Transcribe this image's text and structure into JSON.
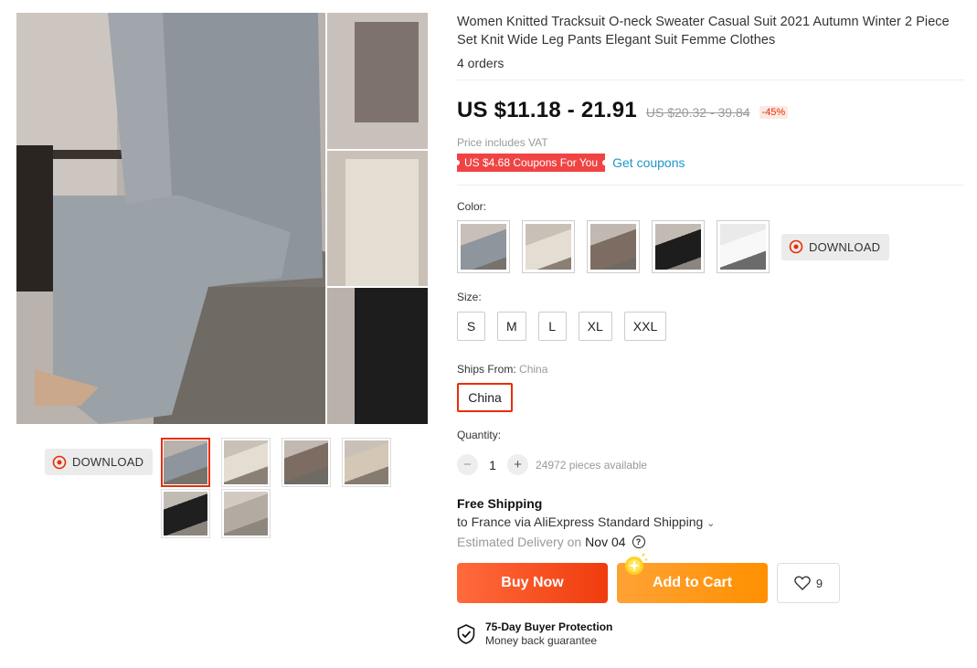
{
  "product": {
    "title": "Women Knitted Tracksuit O-neck Sweater Casual Suit 2021 Autumn Winter 2 Piece Set Knit Wide Leg Pants Elegant Suit Femme Clothes",
    "orders": "4 orders",
    "price": "US $11.18 - 21.91",
    "original_price": "US $20.32 - 39.84",
    "discount": "-45%",
    "vat_note": "Price includes VAT",
    "coupon_badge": "US $4.68 Coupons For You",
    "get_coupons": "Get coupons"
  },
  "gallery": {
    "download_label": "DOWNLOAD",
    "thumbnails": [
      {
        "name": "grey-set",
        "color": "#8e959c"
      },
      {
        "name": "beige-set",
        "color": "#d8cfc2"
      },
      {
        "name": "brown-set",
        "color": "#7d6c62"
      },
      {
        "name": "beige-set-2",
        "color": "#d4c7b6"
      },
      {
        "name": "black-set",
        "color": "#1f1f1f"
      },
      {
        "name": "grey-set-2",
        "color": "#b3aaa2"
      }
    ]
  },
  "color": {
    "label": "Color:",
    "download_label": "DOWNLOAD",
    "options": [
      "#8e959c",
      "#d8cfc2",
      "#7d6c62",
      "#1d1d1d",
      "#f4f4f4"
    ]
  },
  "size": {
    "label": "Size:",
    "options": [
      "S",
      "M",
      "L",
      "XL",
      "XXL"
    ]
  },
  "ships_from": {
    "label": "Ships From:",
    "value": "China",
    "option": "China"
  },
  "quantity": {
    "label": "Quantity:",
    "minus": "−",
    "value": "1",
    "plus": "+",
    "available": "24972 pieces available"
  },
  "shipping": {
    "title": "Free Shipping",
    "line": "to France via AliExpress Standard Shipping",
    "eta_prefix": "Estimated Delivery on",
    "eta_date": "Nov 04"
  },
  "actions": {
    "buy_now": "Buy Now",
    "add_to_cart": "Add to Cart",
    "wishlist_count": "9"
  },
  "protection": {
    "title": "75-Day Buyer Protection",
    "subtitle": "Money back guarantee"
  },
  "colors": {
    "accent": "#e62e04",
    "link": "#2196c9",
    "buy": "#f03c0d",
    "cart": "#ff9000"
  }
}
